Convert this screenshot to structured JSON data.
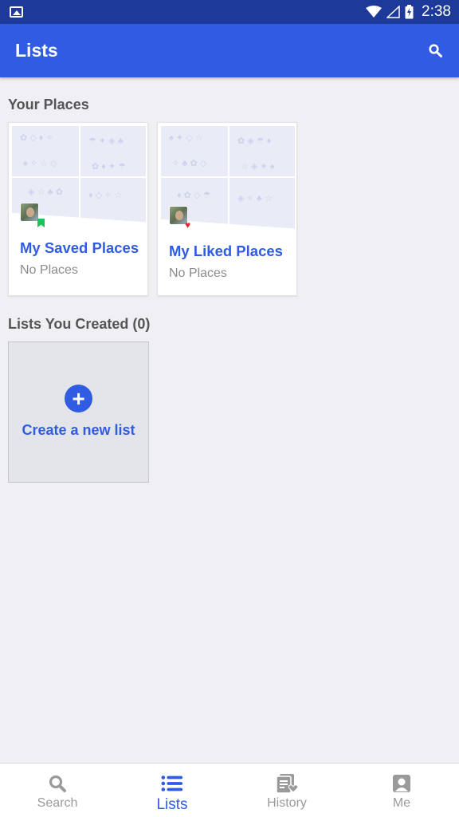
{
  "status_bar": {
    "time": "2:38"
  },
  "app_bar": {
    "title": "Lists"
  },
  "your_places": {
    "heading": "Your Places",
    "cards": [
      {
        "title": "My Saved Places",
        "subtitle": "No Places",
        "badge": "bookmark-icon"
      },
      {
        "title": "My Liked Places",
        "subtitle": "No Places",
        "badge": "heart-icon"
      }
    ]
  },
  "created_lists": {
    "heading": "Lists You Created (0)",
    "create_label": "Create a new list",
    "plus": "+"
  },
  "bottom_nav": {
    "items": [
      {
        "label": "Search",
        "icon": "search-icon",
        "active": false
      },
      {
        "label": "Lists",
        "icon": "list-icon",
        "active": true
      },
      {
        "label": "History",
        "icon": "history-icon",
        "active": false
      },
      {
        "label": "Me",
        "icon": "profile-icon",
        "active": false
      }
    ]
  },
  "colors": {
    "primary": "#2f5ce3",
    "status_bar": "#1d3a9b",
    "saved_badge": "#21c05a",
    "liked_badge": "#e5252f"
  }
}
